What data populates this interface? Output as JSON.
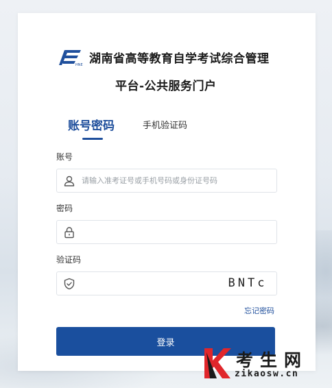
{
  "header": {
    "title_line1": "湖南省高等教育自学考试综合管理",
    "title_line2": "平台-公共服务门户",
    "logo_icon": "hunan-exam-logo"
  },
  "tabs": [
    {
      "label": "账号密码",
      "active": true
    },
    {
      "label": "手机验证码",
      "active": false
    }
  ],
  "form": {
    "account": {
      "label": "账号",
      "placeholder": "请输入准考证号或手机号码或身份证号码",
      "value": "",
      "icon": "user-icon"
    },
    "password": {
      "label": "密码",
      "placeholder": "",
      "value": "",
      "icon": "lock-icon"
    },
    "captcha": {
      "label": "验证码",
      "placeholder": "",
      "value": "",
      "icon": "shield-check-icon",
      "image_text": "BNTc"
    },
    "forgot_label": "忘记密码",
    "submit_label": "登录"
  },
  "watermark": {
    "brand_cn": "考生网",
    "brand_en": "zikaosw.cn"
  },
  "colors": {
    "primary": "#1a4f9e",
    "accent_red": "#e0262b",
    "border": "#dfe3e8"
  }
}
